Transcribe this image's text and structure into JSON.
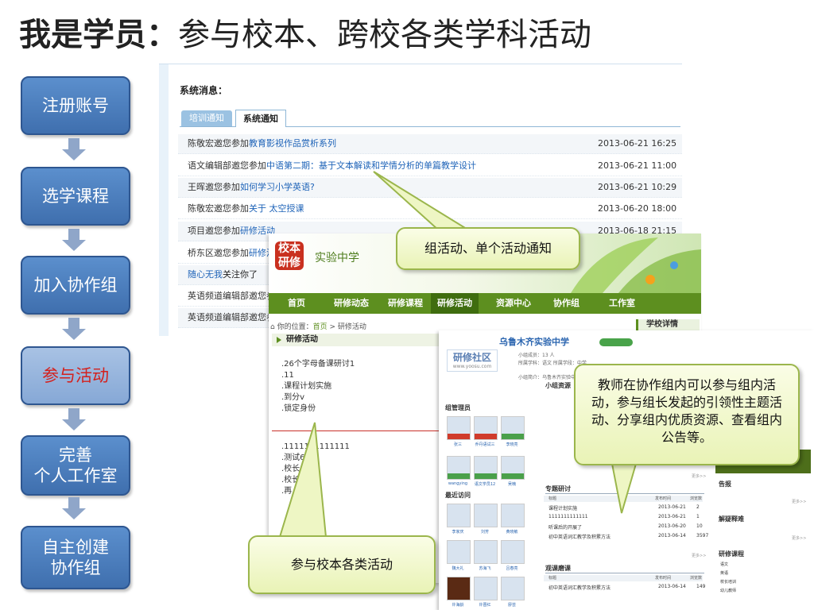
{
  "title": {
    "bold": "我是学员：",
    "rest": "参与校本、跨校各类学科活动"
  },
  "steps": [
    {
      "line1": "注册账号",
      "line2": ""
    },
    {
      "line1": "选学课程",
      "line2": ""
    },
    {
      "line1": "加入协作组",
      "line2": ""
    },
    {
      "line1": "参与活动",
      "line2": ""
    },
    {
      "line1": "完善",
      "line2": "个人工作室"
    },
    {
      "line1": "自主创建",
      "line2": "协作组"
    }
  ],
  "notify": {
    "heading": "系统消息：",
    "tab_training": "培训通知",
    "tab_system": "系统通知",
    "rows": [
      {
        "pre": "陈敬宏邀您参加",
        "link": "教育影视作品赏析系列",
        "date": "2013-06-21 16:25"
      },
      {
        "pre": "语文编辑部邀您参加",
        "link": "中语第二期：基于文本解读和学情分析的单篇教学设计",
        "date": "2013-06-21 11:00"
      },
      {
        "pre": "王晖邀您参加",
        "link": "如何学习小学英语?",
        "date": "2013-06-21 10:29"
      },
      {
        "pre": "陈敬宏邀您参加",
        "link": "关于 太空授课",
        "date": "2013-06-20 18:00"
      },
      {
        "pre": "项目邀您参加",
        "link": "研修活动",
        "date": "2013-06-18 21:15"
      },
      {
        "pre": "桥东区邀您参加",
        "link": "研修活",
        "date": ""
      },
      {
        "pre": "",
        "link": "随心无我",
        "post": "关注你了",
        "date": ""
      },
      {
        "pre": "英语频道编辑部邀您参",
        "link": "",
        "date": ""
      },
      {
        "pre": "英语频道编辑部邀您参",
        "link": "",
        "date": ""
      }
    ]
  },
  "school": {
    "logo": "校本研修",
    "name": "实验中学",
    "nav": [
      "首页",
      "研修动态",
      "研修课程",
      "研修活动",
      "资源中心",
      "协作组",
      "工作室"
    ],
    "crumb_pre": "你的位置：",
    "crumb_home": "首页",
    "crumb_cur": " > 研修活动",
    "section": "研修活动",
    "right_tag": "学校详情",
    "list1": [
      ".26个字母备课研讨1",
      ".11",
      ".课程计划实施",
      ".到分v",
      ".锁定身份"
    ],
    "list2": [
      ".1111111111111",
      ".测试6",
      ".校长",
      ".校长",
      ".再"
    ]
  },
  "group": {
    "logo": "研修社区",
    "logo_sub": "www.yoosu.com",
    "name": "乌鲁木齐实验中学",
    "meta1": "小组成员：13 人",
    "meta2": "所属学科：语文  所属学段：中学",
    "meta3": "小组简介：乌鲁木齐实验中学",
    "managers": "组管理员",
    "recent": "最近访问",
    "resources": "小组资源",
    "topic": "专题研讨",
    "class_obs": "观课磨课",
    "notice": "告报",
    "qa": "解疑释难",
    "courses": "研修课程",
    "col_title": "标题",
    "col_date": "发布时间",
    "col_count": "浏览数",
    "more": "更多>>",
    "topic_rows": [
      {
        "t": "课程计划实施",
        "d": "2013-06-21",
        "n": "2"
      },
      {
        "t": "1111111111111",
        "d": "2013-06-21",
        "n": "1"
      },
      {
        "t": "听课后的开展了",
        "d": "2013-06-20",
        "n": "10"
      },
      {
        "t": "初中英语词汇教学及积累方法",
        "d": "2013-06-14",
        "n": "3597"
      }
    ],
    "obs_rows": [
      {
        "t": "初中英语词汇教学及积累方法",
        "d": "2013-06-14",
        "n": "149"
      }
    ],
    "member_names": [
      "张三",
      "乔丹语试三",
      "李晓亮",
      "wangying",
      "语文学员12",
      "吴楠",
      "李家庆",
      "刘芳",
      "黄晓敏",
      "魏大礼",
      "苏海飞",
      "吕春亮",
      "许海龄",
      "许晋红",
      "廖芸"
    ],
    "course_items": [
      "语文",
      "英语",
      "校长培训",
      "幼儿教师"
    ]
  },
  "callouts": {
    "top": "组活动、单个活动通知",
    "right": "教师在协作组内可以参与组内活动，参与组长发起的引领性主题活动、分享组内优质资源、查看组内公告等。",
    "bottom": "参与校本各类活动"
  },
  "colors": {
    "step_blue": "#4a7fc1",
    "step_active_text": "#d4201c",
    "nav_green": "#5d8f1f",
    "callout_fill": "#eef6c4",
    "link_blue": "#1e63b8"
  }
}
